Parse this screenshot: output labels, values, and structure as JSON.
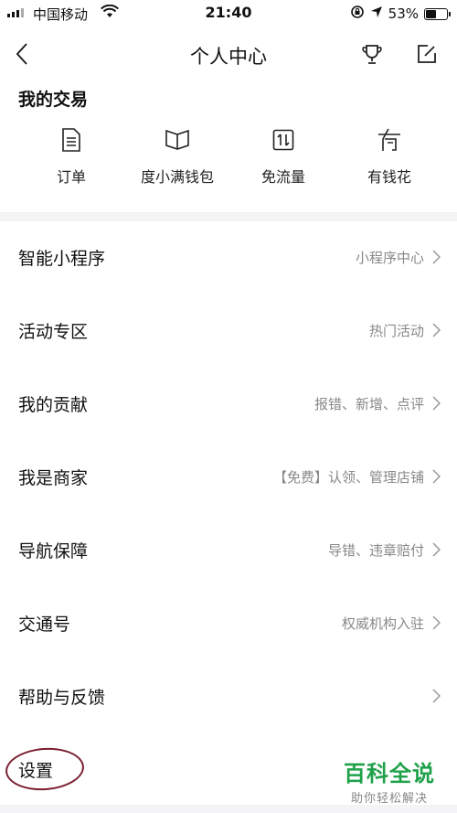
{
  "status_bar": {
    "carrier": "中国移动",
    "time": "21:40",
    "battery_text": "53%",
    "battery_level": 0.53
  },
  "nav": {
    "title": "个人中心",
    "icons": {
      "back": "back-chevron-icon",
      "trophy": "trophy-icon",
      "edit": "edit-icon"
    }
  },
  "transactions": {
    "title": "我的交易",
    "items": [
      {
        "label": "订单",
        "icon": "document-icon"
      },
      {
        "label": "度小满钱包",
        "icon": "wallet-book-icon"
      },
      {
        "label": "免流量",
        "icon": "data-transfer-icon"
      },
      {
        "label": "有钱花",
        "icon": "money-flower-icon"
      }
    ]
  },
  "menu": [
    {
      "label": "智能小程序",
      "value": "小程序中心"
    },
    {
      "label": "活动专区",
      "value": "热门活动"
    },
    {
      "label": "我的贡献",
      "value": "报错、新增、点评"
    },
    {
      "label": "我是商家",
      "value": "【免费】认领、管理店铺"
    },
    {
      "label": "导航保障",
      "value": "导错、违章赔付"
    },
    {
      "label": "交通号",
      "value": "权威机构入驻"
    },
    {
      "label": "帮助与反馈",
      "value": ""
    },
    {
      "label": "设置",
      "value": ""
    }
  ],
  "watermark": {
    "brand": "百科全说",
    "tagline": "助你轻松解决"
  }
}
